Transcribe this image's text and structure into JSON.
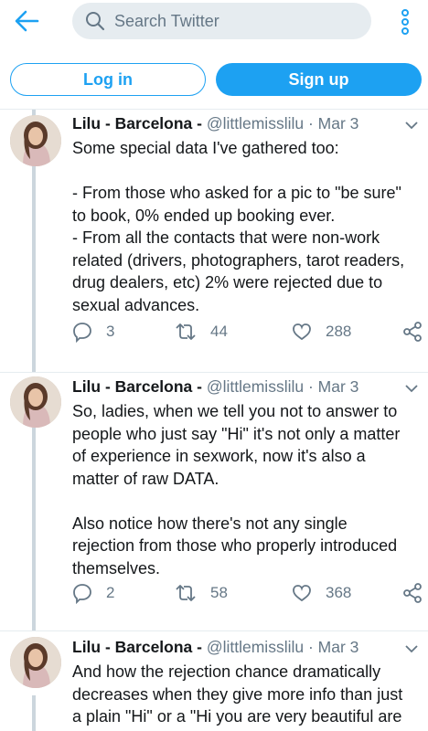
{
  "header": {
    "search_placeholder": "Search Twitter",
    "login_label": "Log in",
    "signup_label": "Sign up"
  },
  "colors": {
    "brand": "#1da1f2",
    "muted": "#657786",
    "thread_line": "#ccd6dd"
  },
  "tweets": [
    {
      "name": "Lilu - Barcelona -",
      "handle": "@littlemisslilu",
      "dot": "·",
      "date": "Mar 3",
      "text": "Some special data I've gathered too:\n\n- From those who asked for a pic to \"be sure\" to book, 0% ended up booking ever.\n- From all the contacts that were non-work related (drivers, photographers, tarot readers, drug dealers, etc) 2% were rejected due to sexual advances.",
      "replies": "3",
      "retweets": "44",
      "likes": "288"
    },
    {
      "name": "Lilu - Barcelona -",
      "handle": "@littlemisslilu",
      "dot": "·",
      "date": "Mar 3",
      "text": "So, ladies, when we tell you not to answer to people who just say \"Hi\" it's not only a matter of experience in sexwork, now it's also a matter of raw DATA.\n\nAlso notice how there's not any single rejection from those who properly introduced themselves.",
      "replies": "2",
      "retweets": "58",
      "likes": "368"
    },
    {
      "name": "Lilu - Barcelona -",
      "handle": "@littlemisslilu",
      "dot": "·",
      "date": "Mar 3",
      "text": "And how the rejection chance dramatically decreases when they give more info than just a plain \"Hi\" or a \"Hi you are very beautiful are u"
    }
  ]
}
